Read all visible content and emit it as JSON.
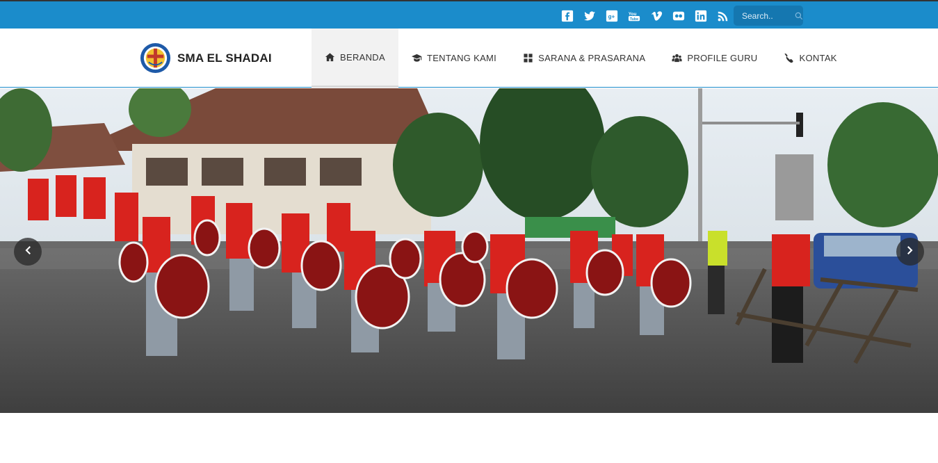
{
  "topbar": {
    "social_icons": [
      "facebook-icon",
      "twitter-icon",
      "google-plus-icon",
      "youtube-icon",
      "vimeo-icon",
      "flickr-icon",
      "linkedin-icon",
      "rss-icon"
    ],
    "search_placeholder": "Search..",
    "color": "#1b8ccb"
  },
  "brand": {
    "name": "SMA EL SHADAI"
  },
  "nav": {
    "items": [
      {
        "label": "BERANDA",
        "icon": "home-icon",
        "active": true
      },
      {
        "label": "TENTANG KAMI",
        "icon": "graduation-cap-icon",
        "active": false
      },
      {
        "label": "SARANA & PRASARANA",
        "icon": "grid-icon",
        "active": false
      },
      {
        "label": "PROFILE GURU",
        "icon": "users-icon",
        "active": false
      },
      {
        "label": "KONTAK",
        "icon": "phone-icon",
        "active": false
      }
    ]
  },
  "slider": {
    "image": "marching-band-photo",
    "prev_icon": "chevron-left-icon",
    "next_icon": "chevron-right-icon"
  }
}
